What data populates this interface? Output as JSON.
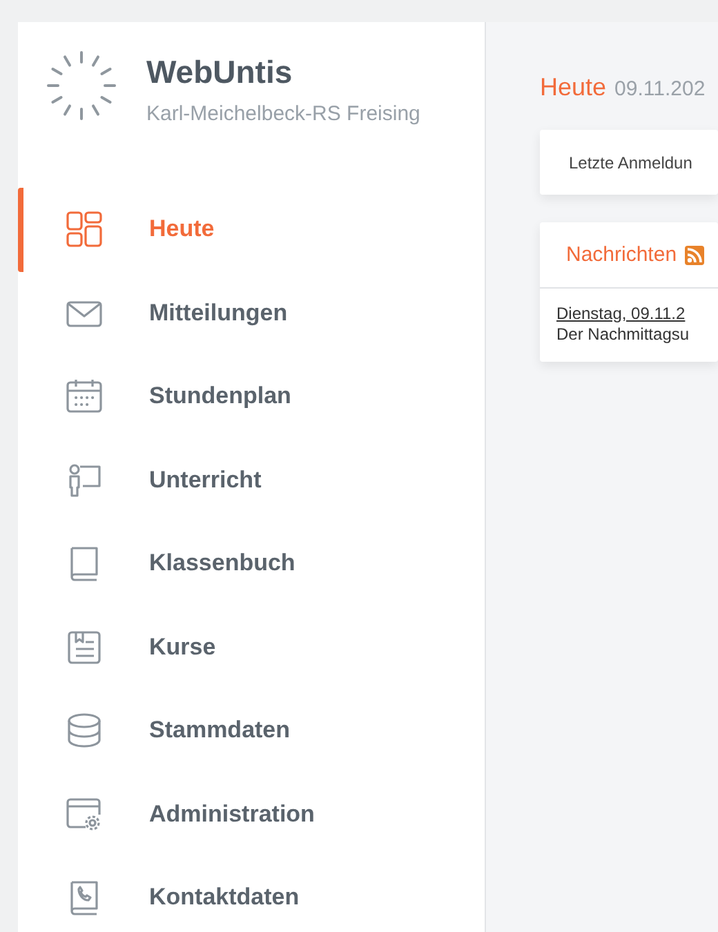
{
  "brand": {
    "title": "WebUntis",
    "school": "Karl-Meichelbeck-RS Freising"
  },
  "nav": [
    {
      "label": "Heute",
      "selected": true
    },
    {
      "label": "Mitteilungen",
      "selected": false
    },
    {
      "label": "Stundenplan",
      "selected": false
    },
    {
      "label": "Unterricht",
      "selected": false
    },
    {
      "label": "Klassenbuch",
      "selected": false
    },
    {
      "label": "Kurse",
      "selected": false
    },
    {
      "label": "Stammdaten",
      "selected": false
    },
    {
      "label": "Administration",
      "selected": false
    },
    {
      "label": "Kontaktdaten",
      "selected": false
    }
  ],
  "page": {
    "title": "Heute",
    "date": "09.11.202"
  },
  "login_card": {
    "text": "Letzte Anmeldun"
  },
  "news": {
    "title": "Nachrichten",
    "items": [
      {
        "date": "Dienstag, 09.11.2",
        "text": "Der Nachmittagsu"
      }
    ]
  }
}
